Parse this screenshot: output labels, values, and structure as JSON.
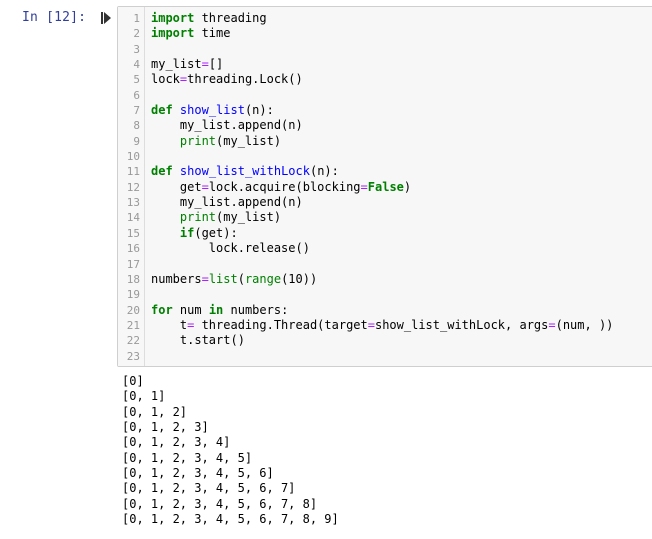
{
  "cell": {
    "prompt": "In  [12]:",
    "run_icon": "run-cell-icon"
  },
  "code": [
    {
      "n": "1",
      "tokens": [
        {
          "t": "import",
          "c": "kw"
        },
        {
          "t": " threading",
          "c": ""
        }
      ]
    },
    {
      "n": "2",
      "tokens": [
        {
          "t": "import",
          "c": "kw"
        },
        {
          "t": " time",
          "c": ""
        }
      ]
    },
    {
      "n": "3",
      "tokens": []
    },
    {
      "n": "4",
      "tokens": [
        {
          "t": "my_list",
          "c": ""
        },
        {
          "t": "=",
          "c": "op"
        },
        {
          "t": "[]",
          "c": ""
        }
      ]
    },
    {
      "n": "5",
      "tokens": [
        {
          "t": "lock",
          "c": ""
        },
        {
          "t": "=",
          "c": "op"
        },
        {
          "t": "threading.Lock()",
          "c": ""
        }
      ]
    },
    {
      "n": "6",
      "tokens": []
    },
    {
      "n": "7",
      "tokens": [
        {
          "t": "def",
          "c": "kw"
        },
        {
          "t": " ",
          "c": ""
        },
        {
          "t": "show_list",
          "c": "fn"
        },
        {
          "t": "(n):",
          "c": ""
        }
      ]
    },
    {
      "n": "8",
      "tokens": [
        {
          "t": "    my_list.append(n)",
          "c": ""
        }
      ]
    },
    {
      "n": "9",
      "tokens": [
        {
          "t": "    ",
          "c": ""
        },
        {
          "t": "print",
          "c": "bi"
        },
        {
          "t": "(my_list)",
          "c": ""
        }
      ]
    },
    {
      "n": "10",
      "tokens": []
    },
    {
      "n": "11",
      "tokens": [
        {
          "t": "def",
          "c": "kw"
        },
        {
          "t": " ",
          "c": ""
        },
        {
          "t": "show_list_withLock",
          "c": "fn"
        },
        {
          "t": "(n):",
          "c": ""
        }
      ]
    },
    {
      "n": "12",
      "tokens": [
        {
          "t": "    get",
          "c": ""
        },
        {
          "t": "=",
          "c": "op"
        },
        {
          "t": "lock.acquire(blocking",
          "c": ""
        },
        {
          "t": "=",
          "c": "op"
        },
        {
          "t": "False",
          "c": "con"
        },
        {
          "t": ")",
          "c": ""
        }
      ]
    },
    {
      "n": "13",
      "tokens": [
        {
          "t": "    my_list.append(n)",
          "c": ""
        }
      ]
    },
    {
      "n": "14",
      "tokens": [
        {
          "t": "    ",
          "c": ""
        },
        {
          "t": "print",
          "c": "bi"
        },
        {
          "t": "(my_list)",
          "c": ""
        }
      ]
    },
    {
      "n": "15",
      "tokens": [
        {
          "t": "    ",
          "c": ""
        },
        {
          "t": "if",
          "c": "kw"
        },
        {
          "t": "(get):",
          "c": ""
        }
      ]
    },
    {
      "n": "16",
      "tokens": [
        {
          "t": "        lock.release()",
          "c": ""
        }
      ]
    },
    {
      "n": "17",
      "tokens": []
    },
    {
      "n": "18",
      "tokens": [
        {
          "t": "numbers",
          "c": ""
        },
        {
          "t": "=",
          "c": "op"
        },
        {
          "t": "list",
          "c": "bi"
        },
        {
          "t": "(",
          "c": ""
        },
        {
          "t": "range",
          "c": "bi"
        },
        {
          "t": "(10))",
          "c": ""
        }
      ]
    },
    {
      "n": "19",
      "tokens": []
    },
    {
      "n": "20",
      "tokens": [
        {
          "t": "for",
          "c": "kw"
        },
        {
          "t": " num ",
          "c": ""
        },
        {
          "t": "in",
          "c": "kw"
        },
        {
          "t": " numbers:",
          "c": ""
        }
      ]
    },
    {
      "n": "21",
      "tokens": [
        {
          "t": "    t",
          "c": ""
        },
        {
          "t": "=",
          "c": "op"
        },
        {
          "t": " threading.Thread(target",
          "c": ""
        },
        {
          "t": "=",
          "c": "op"
        },
        {
          "t": "show_list_withLock, args",
          "c": ""
        },
        {
          "t": "=",
          "c": "op"
        },
        {
          "t": "(num, ))",
          "c": ""
        }
      ]
    },
    {
      "n": "22",
      "tokens": [
        {
          "t": "    t.start()",
          "c": ""
        }
      ]
    },
    {
      "n": "23",
      "tokens": []
    }
  ],
  "output": [
    "[0]",
    "[0, 1]",
    "[0, 1, 2]",
    "[0, 1, 2, 3]",
    "[0, 1, 2, 3, 4]",
    "[0, 1, 2, 3, 4, 5]",
    "[0, 1, 2, 3, 4, 5, 6]",
    "[0, 1, 2, 3, 4, 5, 6, 7]",
    "[0, 1, 2, 3, 4, 5, 6, 7, 8]",
    "[0, 1, 2, 3, 4, 5, 6, 7, 8, 9]"
  ],
  "colors": {
    "prompt": "#303f9f",
    "keyword": "#008000",
    "function_name": "#0000ff",
    "operator": "#aa22ff",
    "cell_background": "#f7f7f7",
    "cell_border": "#cfcfcf"
  }
}
